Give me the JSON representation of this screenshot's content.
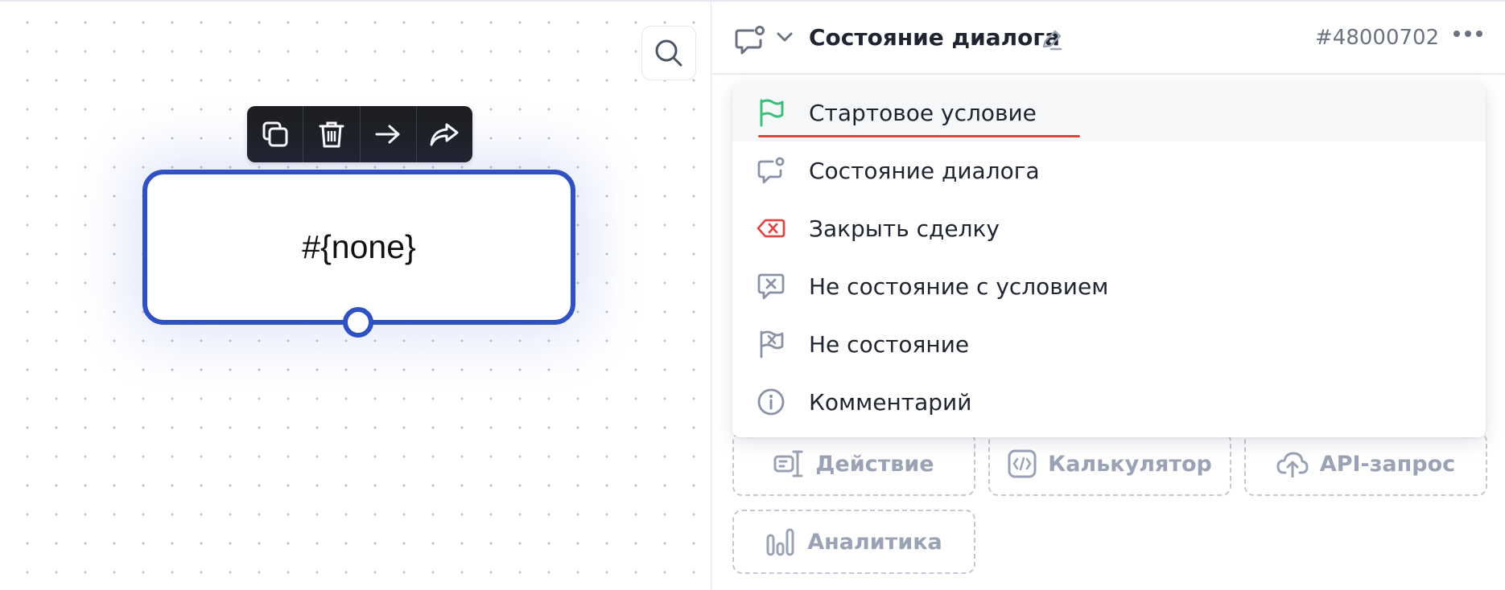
{
  "canvas": {
    "node_label": "#{none}",
    "toolbar": [
      {
        "name": "copy-icon"
      },
      {
        "name": "trash-icon"
      },
      {
        "name": "arrow-right-icon"
      },
      {
        "name": "share-arrow-icon"
      }
    ]
  },
  "panel": {
    "title": "Состояние диалога",
    "id": "#48000702"
  },
  "dropdown": {
    "items": [
      {
        "label": "Стартовое условие",
        "icon": "flag-icon",
        "color": "#3bbf7a"
      },
      {
        "label": "Состояние диалога",
        "icon": "chat-state-icon",
        "color": "#8a93a6"
      },
      {
        "label": "Закрыть сделку",
        "icon": "close-tag-icon",
        "color": "#e04848"
      },
      {
        "label": "Не состояние с условием",
        "icon": "chat-cross-icon",
        "color": "#8a93a6"
      },
      {
        "label": "Не состояние",
        "icon": "flag-cross-icon",
        "color": "#8a93a6"
      },
      {
        "label": "Комментарий",
        "icon": "info-icon",
        "color": "#8a93a6"
      }
    ]
  },
  "tiles": [
    {
      "label": "Действие",
      "icon": "action-icon"
    },
    {
      "label": "Калькулятор",
      "icon": "code-icon"
    },
    {
      "label": "API-запрос",
      "icon": "cloud-upload-icon"
    },
    {
      "label": "Аналитика",
      "icon": "bar-chart-icon"
    }
  ],
  "colors": {
    "node_border": "#2f51c2",
    "accent_underline": "#d8492f",
    "muted": "#9aa3b5"
  }
}
